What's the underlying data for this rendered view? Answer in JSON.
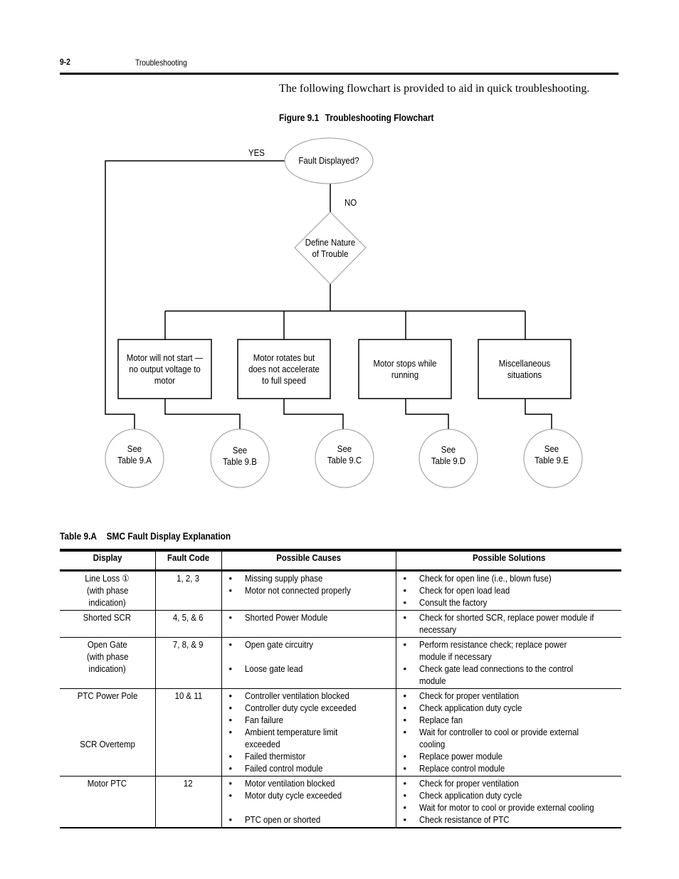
{
  "header": {
    "page_number": "9-2",
    "section_title": "Troubleshooting"
  },
  "intro_text": "The following flowchart is provided to aid in quick troubleshooting.",
  "figure": {
    "number": "Figure 9.1",
    "title": "Troubleshooting Flowchart",
    "start_node": "Fault Displayed?",
    "yes_label": "YES",
    "no_label": "NO",
    "decision_node": [
      "Define Nature",
      "of Trouble"
    ],
    "categories": [
      {
        "label": "Motor will not start — no output voltage to motor"
      },
      {
        "label": "Motor rotates but does not accelerate to full speed"
      },
      {
        "label": "Motor stops while running"
      },
      {
        "label": "Miscellaneous situations"
      }
    ],
    "references": [
      {
        "line1": "See",
        "line2": "Table 9.A"
      },
      {
        "line1": "See",
        "line2": "Table 9.B"
      },
      {
        "line1": "See",
        "line2": "Table 9.C"
      },
      {
        "line1": "See",
        "line2": "Table 9.D"
      },
      {
        "line1": "See",
        "line2": "Table 9.E"
      }
    ]
  },
  "table": {
    "number": "Table 9.A",
    "title": "SMC Fault Display Explanation",
    "columns": [
      "Display",
      "Fault Code",
      "Possible Causes",
      "Possible Solutions"
    ],
    "rows": [
      {
        "display": [
          "Line Loss ①",
          "(with phase",
          "indication)"
        ],
        "fault_code": "1, 2, 3",
        "causes": [
          "Missing supply phase",
          "Motor not connected properly"
        ],
        "solutions": [
          "Check for open line (i.e., blown fuse)",
          "Check for open load lead",
          "Consult the factory"
        ]
      },
      {
        "display": [
          "Shorted SCR"
        ],
        "fault_code": "4, 5, & 6",
        "causes": [
          "Shorted Power Module"
        ],
        "solutions": [
          "Check for shorted SCR, replace power module if necessary"
        ]
      },
      {
        "display": [
          "Open Gate",
          "(with phase",
          "indication)"
        ],
        "fault_code": "7, 8, & 9",
        "causes": [
          "Open gate circuitry",
          "",
          "Loose gate lead"
        ],
        "solutions": [
          "Perform resistance check; replace power module if necessary",
          "Check gate lead connections to the control module"
        ]
      },
      {
        "display": [
          "PTC Power Pole",
          "",
          "",
          "",
          "SCR Overtemp"
        ],
        "fault_code": "10 & 11",
        "causes": [
          "Controller ventilation blocked",
          "Controller duty cycle exceeded",
          "Fan failure",
          "Ambient temperature limit exceeded",
          "Failed thermistor",
          "Failed control module"
        ],
        "solutions": [
          "Check for proper ventilation",
          "Check application duty cycle",
          "Replace fan",
          "Wait for controller to cool or provide external cooling",
          "Replace power module",
          "Replace control module"
        ]
      },
      {
        "display": [
          "Motor PTC"
        ],
        "fault_code": "12",
        "causes": [
          "Motor ventilation blocked",
          "Motor duty cycle exceeded",
          "",
          "PTC open or shorted"
        ],
        "solutions": [
          "Check for proper ventilation",
          "Check application duty cycle",
          "Wait for motor to cool or provide external cooling",
          "Check resistance of PTC"
        ]
      }
    ]
  }
}
